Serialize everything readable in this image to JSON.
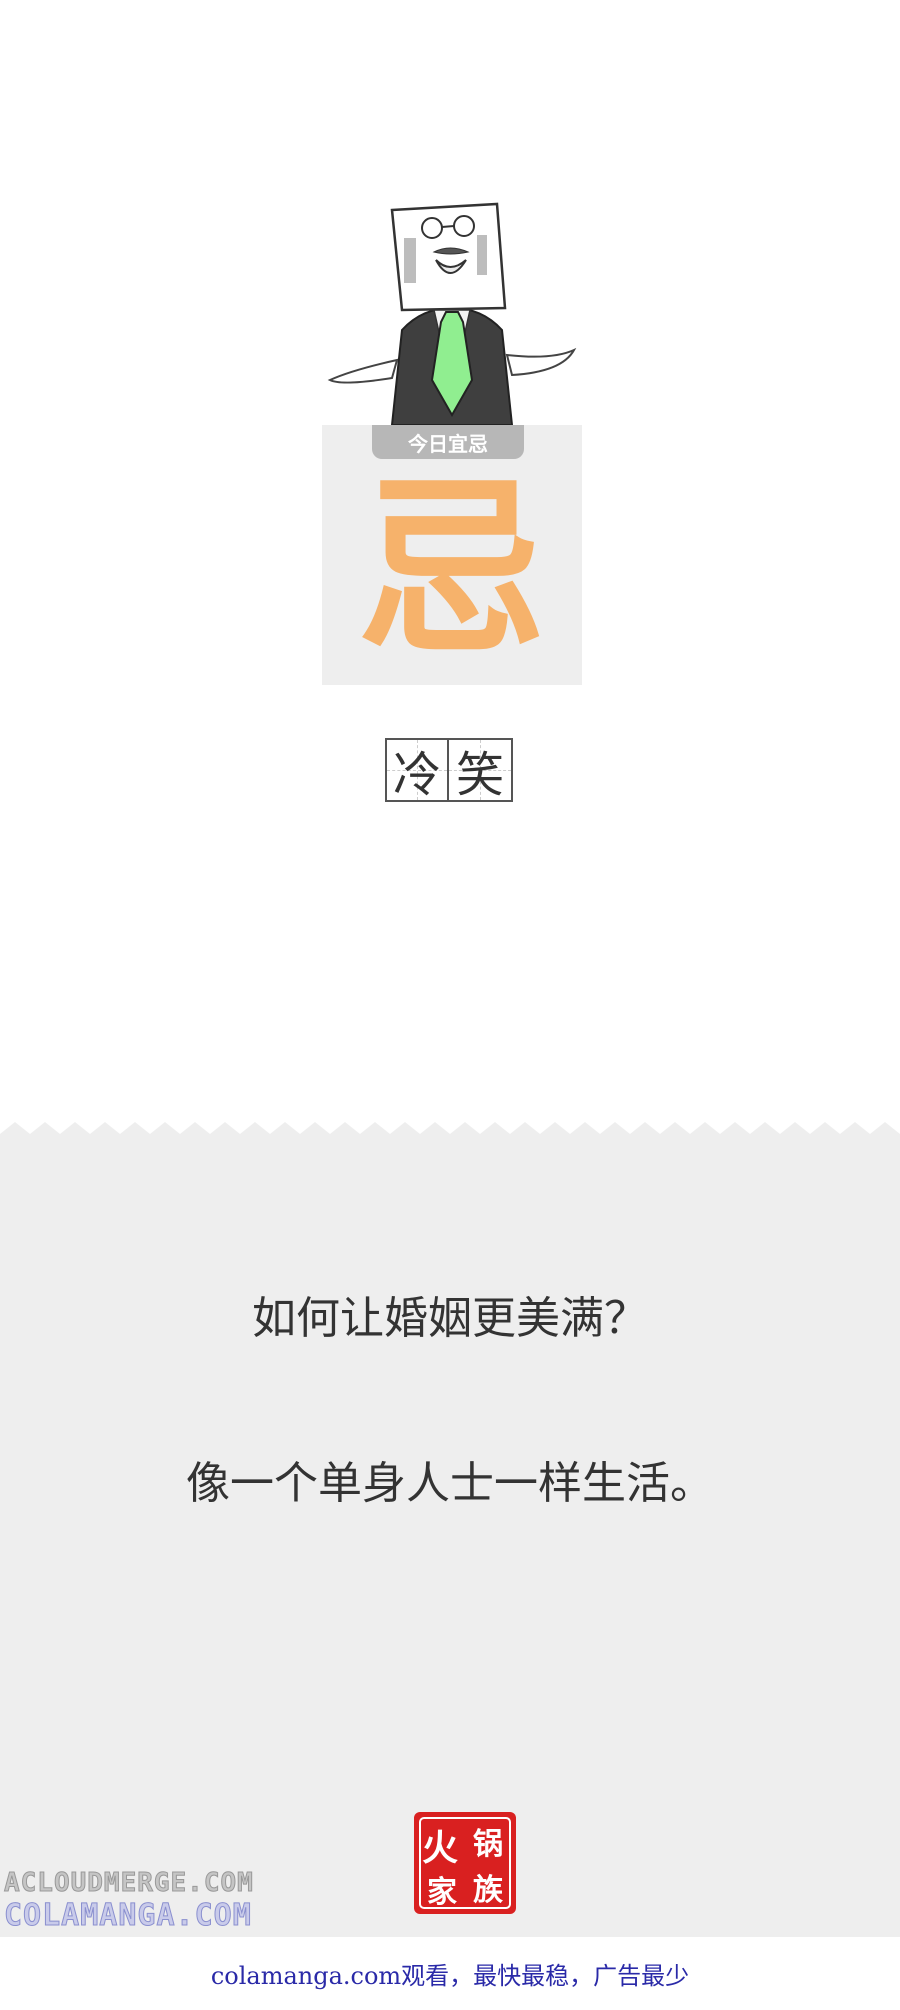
{
  "card": {
    "tab_label": "今日宜忌",
    "character": "忌"
  },
  "label_characters": [
    "冷",
    "笑"
  ],
  "joke": {
    "question": "如何让婚姻更美满？",
    "answer": "像一个单身人士一样生活。"
  },
  "seal": {
    "text": "火锅家族",
    "color": "#d92020"
  },
  "watermarks": {
    "line1": "ACLOUDMERGE.COM",
    "line2": "COLAMANGA.COM"
  },
  "footer": {
    "text": "colamanga.com观看，最快最稳，广告最少"
  },
  "colors": {
    "accent": "#f6b26b",
    "tie": "#90ee90",
    "panel": "#eeeeee"
  }
}
